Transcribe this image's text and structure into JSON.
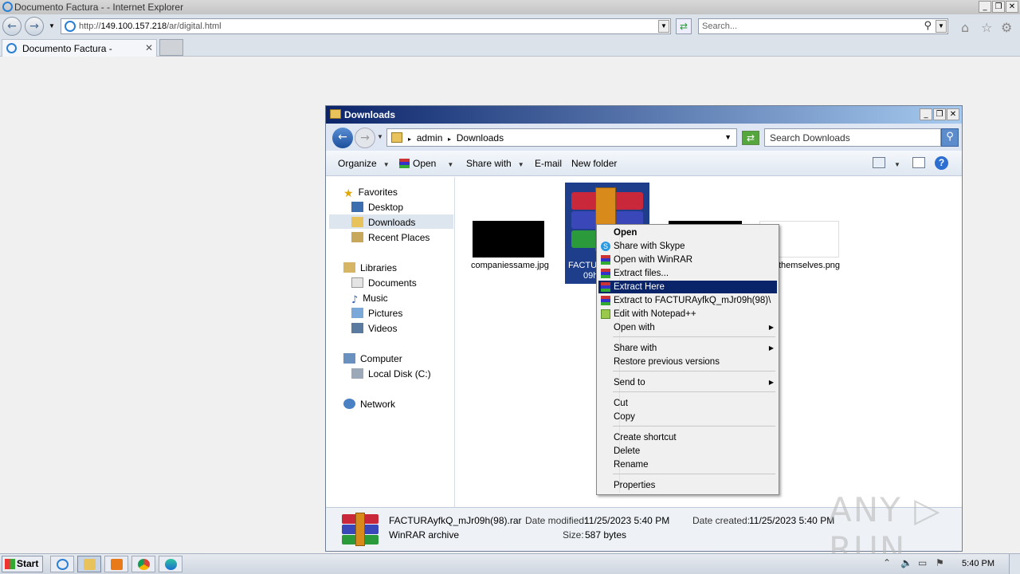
{
  "ie": {
    "title": "Documento Factura - - Internet Explorer",
    "url_prefix": "http://",
    "url_host": "149.100.157.218",
    "url_path": "/ar/digital.html",
    "search_placeholder": "Search...",
    "tab_label": "Documento Factura -",
    "tab_close": "✕",
    "min": "_",
    "max": "❐",
    "close": "✕"
  },
  "explorer": {
    "title": "Downloads",
    "breadcrumb": [
      "admin",
      "Downloads"
    ],
    "search_placeholder": "Search Downloads",
    "toolbar": {
      "organize": "Organize",
      "open": "Open",
      "share_with": "Share with",
      "email": "E-mail",
      "new_folder": "New folder"
    },
    "nav": {
      "favorites": "Favorites",
      "desktop": "Desktop",
      "downloads": "Downloads",
      "recent_places": "Recent Places",
      "libraries": "Libraries",
      "documents": "Documents",
      "music": "Music",
      "pictures": "Pictures",
      "videos": "Videos",
      "computer": "Computer",
      "local_disk": "Local Disk (C:)",
      "network": "Network"
    },
    "files": {
      "f1": "companiessame.jpg",
      "f2_line1": "FACTU",
      "f2_line2": "09h",
      "f4": "themselves.png"
    },
    "details": {
      "filename": "FACTURAyfkQ_mJr09h(98).rar",
      "type": "WinRAR archive",
      "modified_label": "Date modified:",
      "modified_value": "11/25/2023 5:40 PM",
      "created_label": "Date created:",
      "created_value": "11/25/2023 5:40 PM",
      "size_label": "Size:",
      "size_value": "587 bytes"
    }
  },
  "context_menu": {
    "open": "Open",
    "share_skype": "Share with Skype",
    "open_winrar": "Open with WinRAR",
    "extract_files": "Extract files...",
    "extract_here": "Extract Here",
    "extract_to": "Extract to FACTURAyfkQ_mJr09h(98)\\",
    "edit_notepad": "Edit with Notepad++",
    "open_with": "Open with",
    "share_with": "Share with",
    "restore": "Restore previous versions",
    "send_to": "Send to",
    "cut": "Cut",
    "copy": "Copy",
    "create_shortcut": "Create shortcut",
    "delete": "Delete",
    "rename": "Rename",
    "properties": "Properties"
  },
  "taskbar": {
    "start": "Start",
    "clock": "5:40 PM"
  },
  "watermark": "ANY ▷ RUN",
  "colors": {
    "title_bar_start": "#0b246a",
    "title_bar_end": "#a6caf0",
    "menu_highlight": "#0a246a",
    "selection": "#1e3d8a"
  }
}
